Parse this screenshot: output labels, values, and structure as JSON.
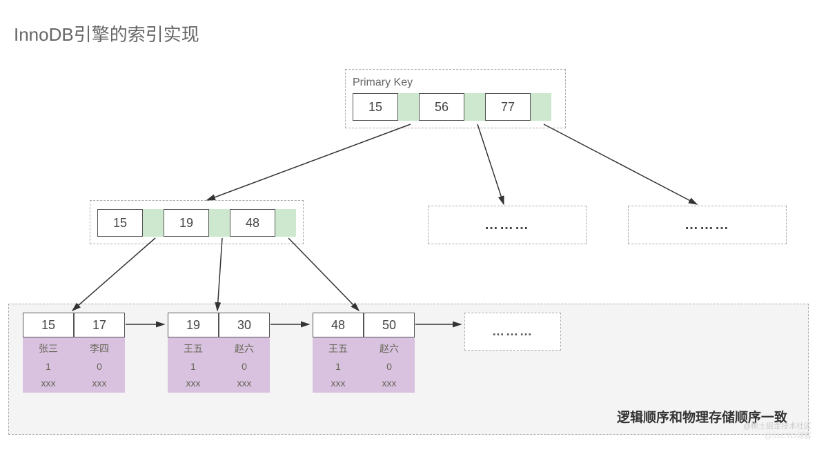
{
  "title": "InnoDB引擎的索引实现",
  "root": {
    "label": "Primary Key",
    "keys": [
      "15",
      "56",
      "77"
    ]
  },
  "internal": {
    "keys": [
      "15",
      "19",
      "48"
    ]
  },
  "placeholder_dots": "………",
  "leaves": [
    {
      "records": [
        {
          "key": "15",
          "name": "张三",
          "flag": "1",
          "extra": "xxx"
        },
        {
          "key": "17",
          "name": "李四",
          "flag": "0",
          "extra": "xxx"
        }
      ]
    },
    {
      "records": [
        {
          "key": "19",
          "name": "王五",
          "flag": "1",
          "extra": "xxx"
        },
        {
          "key": "30",
          "name": "赵六",
          "flag": "0",
          "extra": "xxx"
        }
      ]
    },
    {
      "records": [
        {
          "key": "48",
          "name": "王五",
          "flag": "1",
          "extra": "xxx"
        },
        {
          "key": "50",
          "name": "赵六",
          "flag": "0",
          "extra": "xxx"
        }
      ]
    }
  ],
  "caption": "逻辑顺序和物理存储顺序一致",
  "watermark1": "@稀土掘金技术社区",
  "watermark2": "@51CTO博客",
  "chart_data": {
    "type": "tree",
    "description": "InnoDB clustered B+Tree index on Primary Key",
    "root_keys": [
      15,
      56,
      77
    ],
    "internal_nodes": [
      {
        "keys": [
          15,
          19,
          48
        ]
      },
      {
        "keys": "…"
      },
      {
        "keys": "…"
      }
    ],
    "leaf_pages": [
      {
        "rows": [
          {
            "pk": 15,
            "name": "张三",
            "col": 1,
            "col2": "xxx"
          },
          {
            "pk": 17,
            "name": "李四",
            "col": 0,
            "col2": "xxx"
          }
        ]
      },
      {
        "rows": [
          {
            "pk": 19,
            "name": "王五",
            "col": 1,
            "col2": "xxx"
          },
          {
            "pk": 30,
            "name": "赵六",
            "col": 0,
            "col2": "xxx"
          }
        ]
      },
      {
        "rows": [
          {
            "pk": 48,
            "name": "王五",
            "col": 1,
            "col2": "xxx"
          },
          {
            "pk": 50,
            "name": "赵六",
            "col": 0,
            "col2": "xxx"
          }
        ]
      },
      {
        "rows": "…"
      }
    ],
    "leaf_linked_list": true,
    "note": "逻辑顺序和物理存储顺序一致"
  }
}
